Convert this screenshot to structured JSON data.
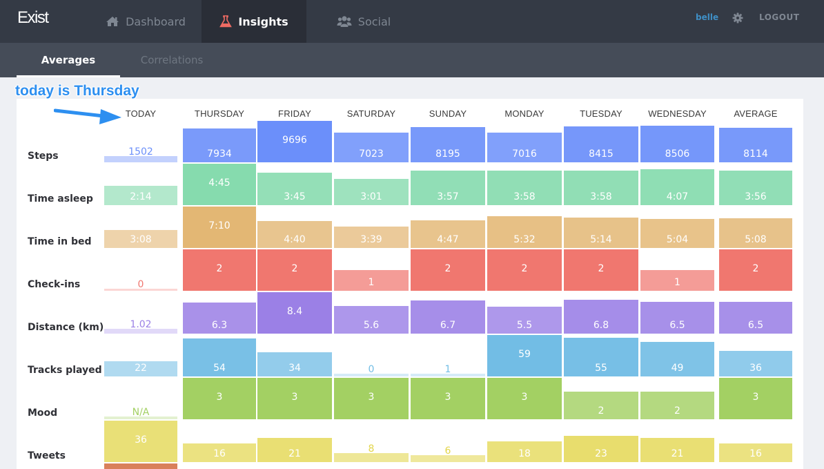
{
  "app": {
    "logo": "Exist",
    "nav": [
      {
        "label": "Dashboard",
        "icon": "home-icon",
        "active": false
      },
      {
        "label": "Insights",
        "icon": "flask-icon",
        "active": true
      },
      {
        "label": "Social",
        "icon": "users-icon",
        "active": false
      }
    ],
    "user": "belle",
    "logout": "LOGOUT"
  },
  "subnav": [
    {
      "label": "Averages",
      "active": true
    },
    {
      "label": "Correlations",
      "active": false
    }
  ],
  "annotation": "today is Thursday",
  "columns": [
    "TODAY",
    "THURSDAY",
    "FRIDAY",
    "SATURDAY",
    "SUNDAY",
    "MONDAY",
    "TUESDAY",
    "WEDNESDAY",
    "AVERAGE"
  ],
  "chart_data": {
    "type": "bar",
    "title": "Averages",
    "categories": [
      "TODAY",
      "THURSDAY",
      "FRIDAY",
      "SATURDAY",
      "SUNDAY",
      "MONDAY",
      "TUESDAY",
      "WEDNESDAY",
      "AVERAGE"
    ],
    "series": [
      {
        "name": "Steps",
        "color": "#6b8ffa",
        "labels": [
          "1502",
          "7934",
          "9696",
          "7023",
          "8195",
          "7016",
          "8415",
          "8506",
          "8114"
        ],
        "values": [
          1502,
          7934,
          9696,
          7023,
          8195,
          7016,
          8415,
          8506,
          8114
        ],
        "max": 9696
      },
      {
        "name": "Time asleep",
        "color": "#86dbae",
        "labels": [
          "2:14",
          "4:45",
          "3:45",
          "3:01",
          "3:57",
          "3:58",
          "3:58",
          "4:07",
          "3:56"
        ],
        "values": [
          134,
          285,
          225,
          181,
          237,
          238,
          238,
          247,
          236
        ],
        "max": 285
      },
      {
        "name": "Time in bed",
        "color": "#e3b774",
        "labels": [
          "3:08",
          "7:10",
          "4:40",
          "3:39",
          "4:47",
          "5:32",
          "5:14",
          "5:04",
          "5:08"
        ],
        "values": [
          188,
          430,
          280,
          219,
          287,
          332,
          314,
          304,
          308
        ],
        "max": 430
      },
      {
        "name": "Check-ins",
        "color": "#f0776f",
        "labels": [
          "0",
          "2",
          "2",
          "1",
          "2",
          "2",
          "2",
          "1",
          "2"
        ],
        "values": [
          0,
          2,
          2,
          1,
          2,
          2,
          2,
          1,
          2
        ],
        "max": 2
      },
      {
        "name": "Distance (km)",
        "color": "#9b80e6",
        "labels": [
          "1.02",
          "6.3",
          "8.4",
          "5.6",
          "6.7",
          "5.5",
          "6.8",
          "6.5",
          "6.5"
        ],
        "values": [
          1.02,
          6.3,
          8.4,
          5.6,
          6.7,
          5.5,
          6.8,
          6.5,
          6.5
        ],
        "max": 8.4
      },
      {
        "name": "Tracks played",
        "color": "#72bde5",
        "labels": [
          "22",
          "54",
          "34",
          "0",
          "1",
          "59",
          "55",
          "49",
          "36"
        ],
        "values": [
          22,
          54,
          34,
          0,
          1,
          59,
          55,
          49,
          36
        ],
        "max": 59
      },
      {
        "name": "Mood",
        "color": "#a3d063",
        "labels": [
          "N/A",
          "3",
          "3",
          "3",
          "3",
          "3",
          "2",
          "2",
          "3"
        ],
        "values": [
          0,
          3,
          3,
          3,
          3,
          3,
          2,
          2,
          3
        ],
        "max": 3
      },
      {
        "name": "Tweets",
        "color": "#e2d549",
        "labels": [
          "36",
          "16",
          "21",
          "8",
          "6",
          "18",
          "23",
          "21",
          "16"
        ],
        "values": [
          36,
          16,
          21,
          8,
          6,
          18,
          23,
          21,
          16
        ],
        "max": 36
      }
    ]
  }
}
